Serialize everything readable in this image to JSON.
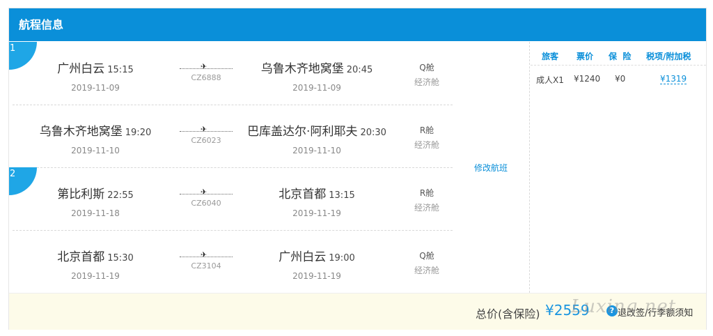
{
  "header": {
    "title": "航程信息"
  },
  "segments": [
    {
      "number": "1"
    },
    {
      "number": "2"
    }
  ],
  "flights": [
    {
      "from_city": "广州白云",
      "from_time": "15:15",
      "from_date": "2019-11-09",
      "flight_no": "CZ6888",
      "to_city": "乌鲁木齐地窝堡",
      "to_time": "20:45",
      "to_date": "2019-11-09",
      "cabin": "Q舱",
      "cabin_class": "经济舱"
    },
    {
      "from_city": "乌鲁木齐地窝堡",
      "from_time": "19:20",
      "from_date": "2019-11-10",
      "flight_no": "CZ6023",
      "to_city": "巴库盖达尔·阿利耶夫",
      "to_time": "20:30",
      "to_date": "2019-11-10",
      "cabin": "R舱",
      "cabin_class": "经济舱"
    },
    {
      "from_city": "第比利斯",
      "from_time": "22:55",
      "from_date": "2019-11-18",
      "flight_no": "CZ6040",
      "to_city": "北京首都",
      "to_time": "13:15",
      "to_date": "2019-11-19",
      "cabin": "R舱",
      "cabin_class": "经济舱"
    },
    {
      "from_city": "北京首都",
      "from_time": "15:30",
      "from_date": "2019-11-19",
      "flight_no": "CZ3104",
      "to_city": "广州白云",
      "to_time": "19:00",
      "to_date": "2019-11-19",
      "cabin": "Q舱",
      "cabin_class": "经济舱"
    }
  ],
  "modify_label": "修改航班",
  "price_table": {
    "headers": {
      "passenger": "旅客",
      "fare": "票价",
      "insurance": "保  险",
      "tax": "税项/附加税"
    },
    "row": {
      "passenger": "成人X1",
      "fare": "¥1240",
      "insurance": "¥0",
      "tax": "¥1319"
    }
  },
  "footer": {
    "total_label": "总价(含保险)",
    "total_price": "¥2559",
    "help_icon": "question-circle-icon",
    "help_glyph": "?",
    "rules_link": "退改签/行李额须知"
  },
  "watermark": "Luxing.net",
  "colors": {
    "header_bg": "#0a8fd9",
    "badge": "#1fa6e6",
    "accent": "#1a95e0",
    "footer_bg": "#fdfbe9"
  }
}
